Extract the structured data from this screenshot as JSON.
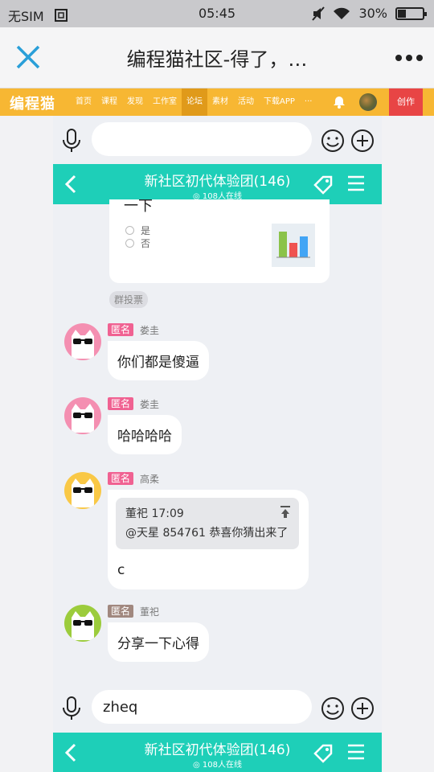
{
  "status": {
    "carrier": "无SIM",
    "time": "05:45",
    "battery": "30%"
  },
  "window": {
    "title": "编程猫社区-得了，…"
  },
  "site_nav": {
    "logo": "编程猫",
    "links": [
      "首页",
      "课程",
      "发现",
      "工作室",
      "论坛",
      "素材",
      "活动",
      "下载APP",
      "···"
    ],
    "active_link": "论坛",
    "create_label": "创作"
  },
  "top_input": {
    "value": "",
    "placeholder": ""
  },
  "group": {
    "name": "新社区初代体验团(146)",
    "online": "108人在线"
  },
  "vote": {
    "question": "一下",
    "options": [
      "是",
      "否"
    ],
    "label": "群投票"
  },
  "messages": [
    {
      "badge": "匿名",
      "badge_color": "#f06292",
      "user": "娄圭",
      "text": "你们都是傻逼",
      "avatar_color": "#f48fb1"
    },
    {
      "badge": "匿名",
      "badge_color": "#f06292",
      "user": "娄圭",
      "text": "哈哈哈哈",
      "avatar_color": "#f48fb1"
    },
    {
      "badge": "匿名",
      "badge_color": "#f06292",
      "user": "高柔",
      "text": "c",
      "avatar_color": "#f9c846",
      "quote": {
        "author": "董祀 17:09",
        "text": "@天星 854761 恭喜你猜出来了"
      }
    },
    {
      "badge": "匿名",
      "badge_color": "#a1887f",
      "user": "董祀",
      "text": "分享一下心得",
      "avatar_color": "#9ccc3c"
    }
  ],
  "bottom_input": {
    "value": "zheq"
  },
  "colors": {
    "accent": "#1ecfb8",
    "site_nav": "#f7b733",
    "create": "#e84545"
  }
}
